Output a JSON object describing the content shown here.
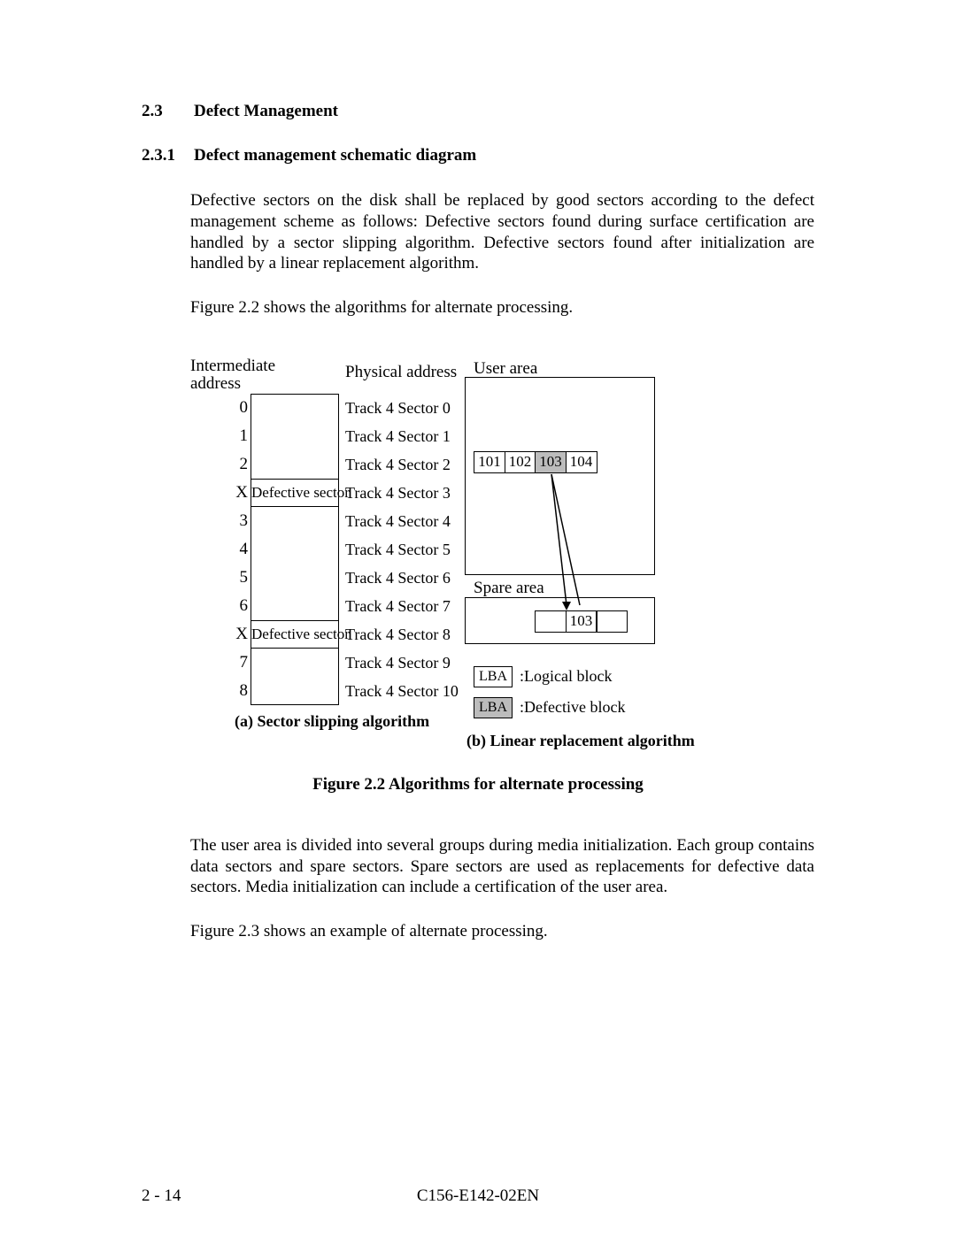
{
  "section": {
    "num23": "2.3",
    "title23": "Defect Management",
    "num231": "2.3.1",
    "title231": "Defect management schematic diagram"
  },
  "para1": "Defective sectors on the disk shall be replaced by good sectors according to the defect management scheme as follows:  Defective sectors found during surface certification are handled by a sector slipping algorithm.  Defective sectors found after initialization are handled by a linear replacement algorithm.",
  "para2": "Figure 2.2 shows the algorithms for alternate processing.",
  "para3": "The user area is divided into several groups during media initialization.  Each group contains data sectors and spare sectors.  Spare sectors are used as replacements for defective data sectors.  Media initialization can include a certification of the user area.",
  "para4": "Figure 2.3 shows an example of alternate processing.",
  "diagram": {
    "intermediate_label1": "Intermediate",
    "intermediate_label2": "address",
    "physical_label": "Physical address",
    "rows": [
      {
        "ia": "0",
        "label": "",
        "phys": "Track 4 Sector 0"
      },
      {
        "ia": "1",
        "label": "",
        "phys": "Track 4 Sector 1"
      },
      {
        "ia": "2",
        "label": "",
        "phys": "Track 4 Sector 2"
      },
      {
        "ia": "X",
        "label": "Defective sector",
        "phys": "Track 4 Sector 3"
      },
      {
        "ia": "3",
        "label": "",
        "phys": "Track 4 Sector 4"
      },
      {
        "ia": "4",
        "label": "",
        "phys": "Track 4 Sector 5"
      },
      {
        "ia": "5",
        "label": "",
        "phys": "Track 4 Sector 6"
      },
      {
        "ia": "6",
        "label": "",
        "phys": "Track 4 Sector 7"
      },
      {
        "ia": "X",
        "label": "Defective sector",
        "phys": "Track 4 Sector 8"
      },
      {
        "ia": "7",
        "label": "",
        "phys": "Track 4 Sector 9"
      },
      {
        "ia": "8",
        "label": "",
        "phys": "Track 4 Sector 10"
      }
    ],
    "caption_a": "(a) Sector slipping algorithm",
    "user_area_label": "User area",
    "user_lbas": [
      "101",
      "102",
      "103",
      "104"
    ],
    "user_shaded_index": 2,
    "spare_area_label": "Spare area",
    "spare_lbas": [
      "",
      "103",
      ""
    ],
    "legend_box": "LBA",
    "legend1_text": ":Logical block",
    "legend2_text": ":Defective block",
    "caption_b": "(b) Linear replacement algorithm"
  },
  "fig_caption": "Figure 2.2    Algorithms for alternate processing",
  "footer": {
    "left": "2 - 14",
    "center": "C156-E142-02EN"
  }
}
